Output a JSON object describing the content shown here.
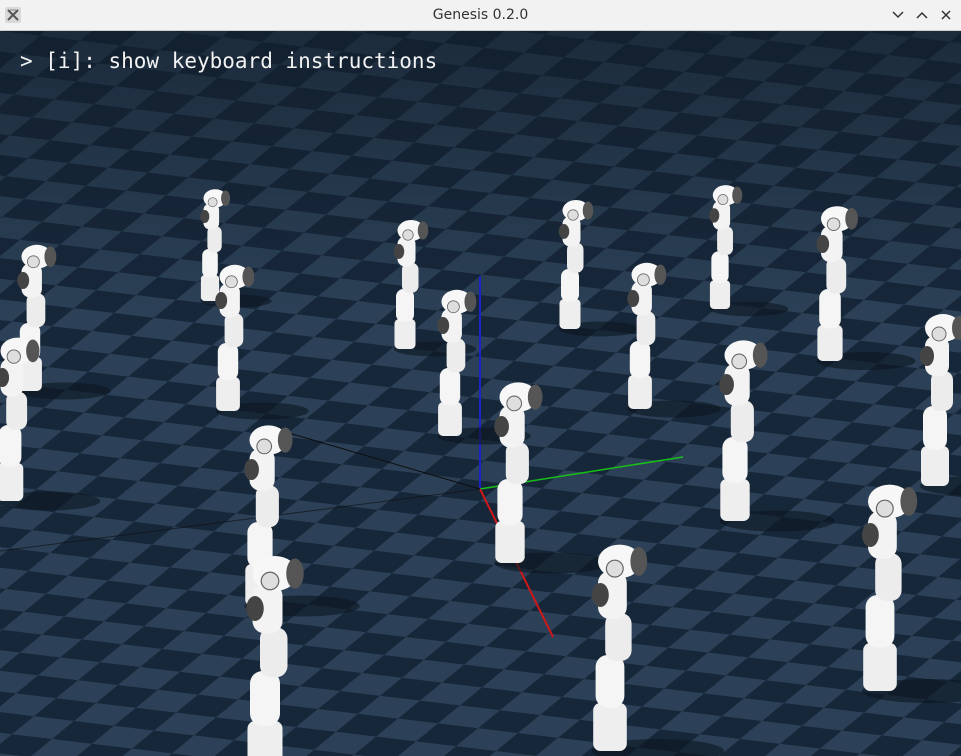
{
  "window": {
    "title": "Genesis 0.2.0",
    "controls": [
      "minimize-icon",
      "maximize-icon",
      "close-icon"
    ]
  },
  "viewer": {
    "overlay_text": "> [i]: show keyboard instructions",
    "floor_colors": {
      "light": "#2c4157",
      "dark": "#17273a"
    },
    "axis_colors": {
      "x": "#d01818",
      "y": "#18c018",
      "z": "#1c24c8"
    },
    "robot_color": "#f2f2f2"
  }
}
